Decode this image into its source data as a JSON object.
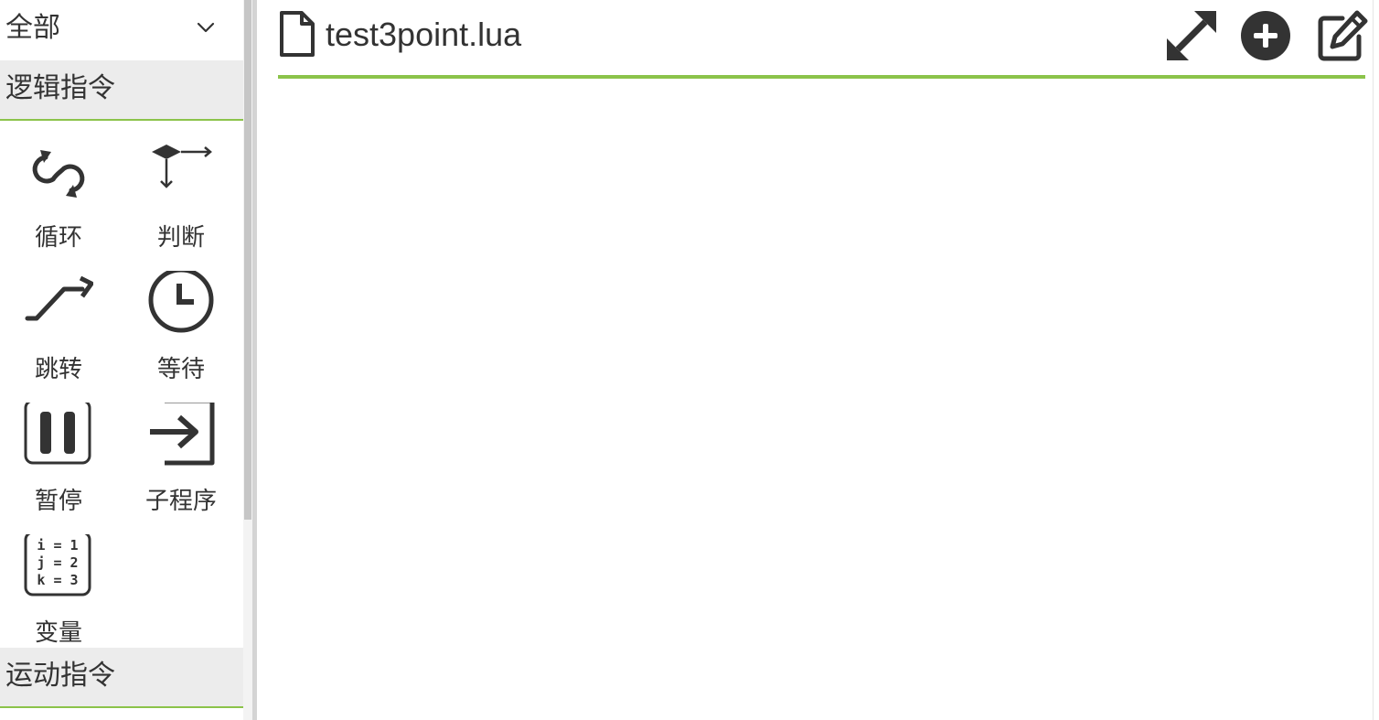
{
  "sidebar": {
    "filter": {
      "selected": "全部",
      "icon": "chevron-down-icon"
    },
    "sections": [
      {
        "title": "逻辑指令",
        "tools": [
          {
            "label": "循环",
            "icon": "loop-icon"
          },
          {
            "label": "判断",
            "icon": "branch-icon"
          },
          {
            "label": "跳转",
            "icon": "jump-icon"
          },
          {
            "label": "等待",
            "icon": "clock-icon"
          },
          {
            "label": "暂停",
            "icon": "pause-icon"
          },
          {
            "label": "子程序",
            "icon": "subroutine-icon"
          },
          {
            "label": "变量",
            "icon": "variable-icon",
            "icon_text": [
              "i = 1",
              "j = 2",
              "k = 3"
            ]
          }
        ]
      },
      {
        "title": "运动指令"
      }
    ]
  },
  "editor": {
    "file_name": "test3point.lua",
    "file_icon": "file-icon",
    "actions": [
      {
        "name": "expand",
        "icon": "expand-icon"
      },
      {
        "name": "add",
        "icon": "plus-circle-icon"
      },
      {
        "name": "edit",
        "icon": "edit-icon"
      }
    ]
  },
  "colors": {
    "accent": "#8bc34a",
    "section_bg": "#ececec",
    "text": "#333333"
  }
}
